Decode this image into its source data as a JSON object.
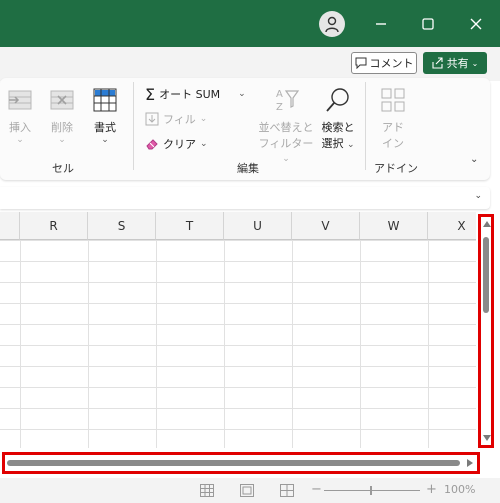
{
  "ribbon": {
    "comment_button": "コメント",
    "share_button": "共有",
    "cells_group": {
      "insert": "挿入",
      "delete": "削除",
      "format": "書式",
      "label": "セル"
    },
    "editing_group": {
      "autosum": "オート SUM",
      "fill": "フィル",
      "clear": "クリア",
      "sort_filter_line1": "並べ替えと",
      "sort_filter_line2": "フィルター",
      "find_select_line1": "検索と",
      "find_select_line2": "選択",
      "label": "編集"
    },
    "addins_group": {
      "addins_line1": "アド",
      "addins_line2": "イン",
      "label": "アドイン"
    }
  },
  "sheet": {
    "columns": [
      "R",
      "S",
      "T",
      "U",
      "V",
      "W",
      "X"
    ]
  },
  "statusbar": {
    "zoom_minus": "−",
    "zoom_plus": "+",
    "zoom_level": "100%"
  },
  "colors": {
    "brand_green": "#1f6e43",
    "highlight_red": "#e00000"
  }
}
